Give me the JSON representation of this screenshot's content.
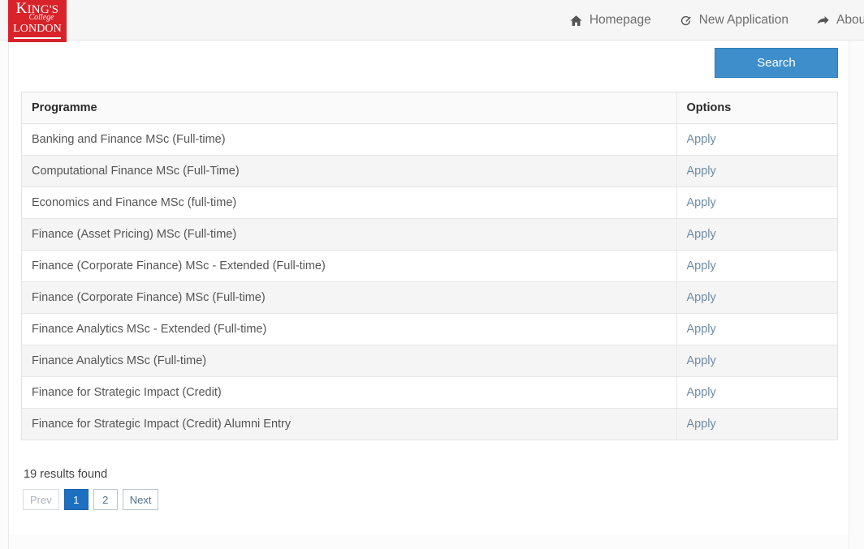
{
  "brand": {
    "logo_line1_initial": "K",
    "logo_line1_rest": "ING'S",
    "logo_line2": "College",
    "logo_line3": "LONDON"
  },
  "nav": {
    "items": [
      {
        "label": "Homepage",
        "icon": "home-icon"
      },
      {
        "label": "New Application",
        "icon": "edit-circle-icon"
      },
      {
        "label": "About U",
        "icon": "arrow-share-icon"
      }
    ]
  },
  "search": {
    "button_label": "Search"
  },
  "table": {
    "columns": [
      "Programme",
      "Options"
    ],
    "rows": [
      {
        "programme": "Banking and Finance MSc (Full-time)",
        "option": "Apply"
      },
      {
        "programme": "Computational Finance MSc (Full-Time)",
        "option": "Apply"
      },
      {
        "programme": "Economics and Finance MSc (full-time)",
        "option": "Apply"
      },
      {
        "programme": "Finance (Asset Pricing) MSc (Full-time)",
        "option": "Apply"
      },
      {
        "programme": "Finance (Corporate Finance) MSc - Extended (Full-time)",
        "option": "Apply"
      },
      {
        "programme": "Finance (Corporate Finance) MSc (Full-time)",
        "option": "Apply"
      },
      {
        "programme": "Finance Analytics MSc - Extended (Full-time)",
        "option": "Apply"
      },
      {
        "programme": "Finance Analytics MSc (Full-time)",
        "option": "Apply"
      },
      {
        "programme": "Finance for Strategic Impact (Credit)",
        "option": "Apply"
      },
      {
        "programme": "Finance for Strategic Impact (Credit) Alumni Entry",
        "option": "Apply"
      }
    ]
  },
  "results": {
    "text": "19 results found"
  },
  "pagination": {
    "prev_label": "Prev",
    "next_label": "Next",
    "pages": [
      "1",
      "2"
    ],
    "active_page": "1"
  },
  "colors": {
    "brand_red": "#d8232a",
    "search_blue": "#3d8ecb",
    "active_page_blue": "#1d6fc0",
    "link_blue": "#6d8ca6"
  }
}
